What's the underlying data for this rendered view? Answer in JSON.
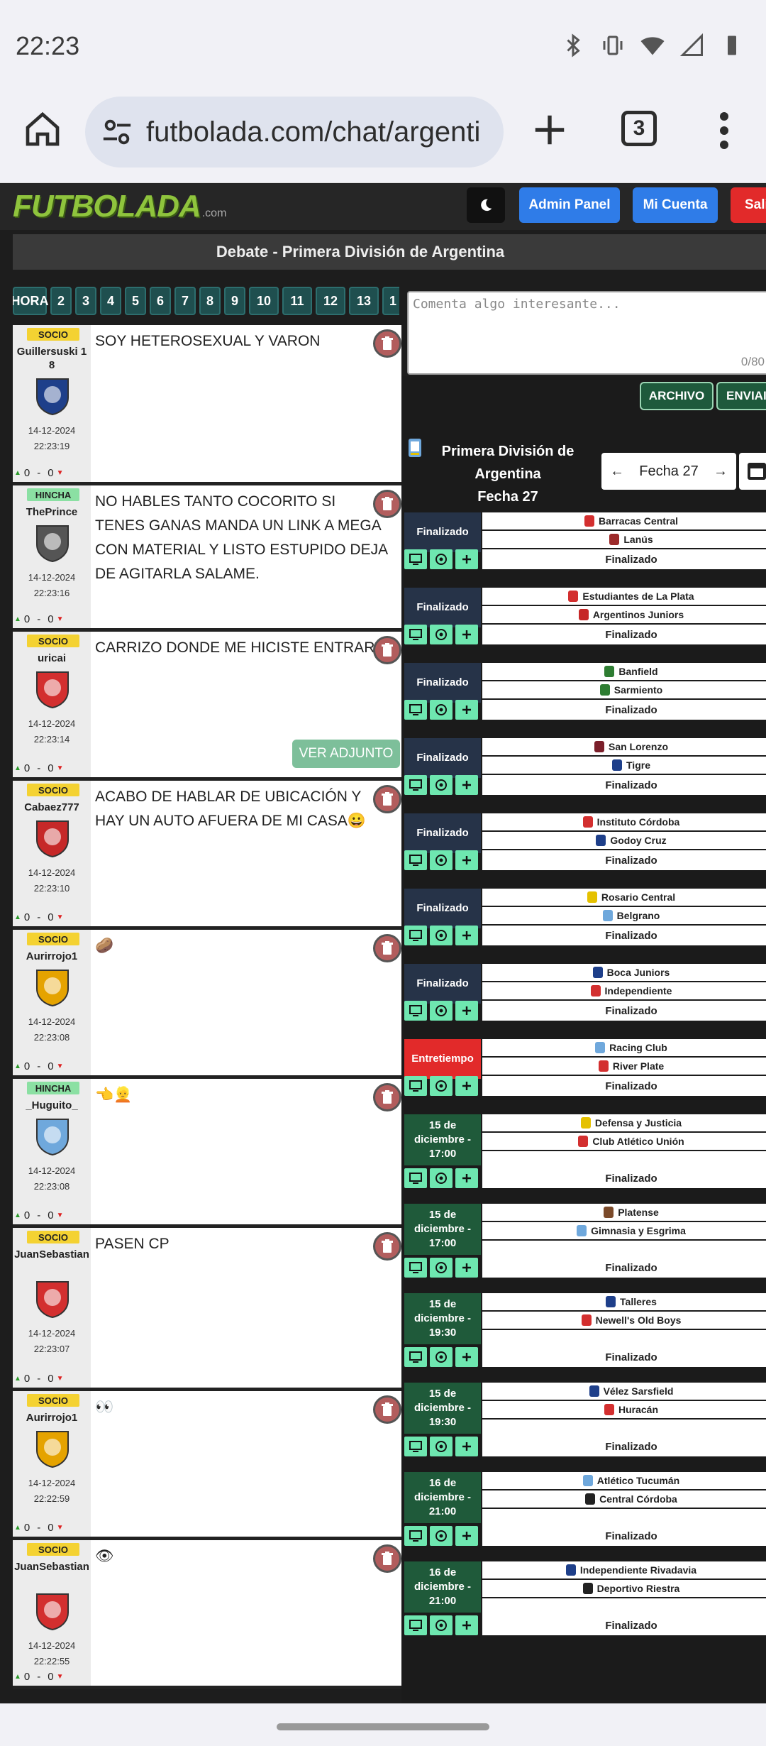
{
  "status": {
    "time": "22:23"
  },
  "browser": {
    "url": "futbolada.com/chat/argenti",
    "tab_count": "3"
  },
  "header": {
    "logo_text": "FUTBOLADA",
    "logo_suffix": ".com",
    "admin_label": "Admin Panel",
    "cuenta_label": "Mi Cuenta",
    "salir_label": "Sali"
  },
  "debate_title": "Debate - Primera División de Argentina",
  "hour_tabs": [
    "HORA",
    "2",
    "3",
    "4",
    "5",
    "6",
    "7",
    "8",
    "9",
    "10",
    "11",
    "12",
    "13",
    "1"
  ],
  "messages": [
    {
      "role": "SOCIO",
      "user": "Guillersuski 18",
      "date": "14-12-2024",
      "time": "22:23:19",
      "up": "0",
      "down": "0",
      "text": "SOY HETEROSEXUAL Y VARON",
      "crest": "#1e3f8a"
    },
    {
      "role": "HINCHA",
      "user": "ThePrince",
      "date": "14-12-2024",
      "time": "22:23:16",
      "up": "0",
      "down": "0",
      "text": "NO HABLES TANTO COCORITO SI TENES GANAS MANDA UN LINK A MEGA CON MATERIAL Y LISTO ESTUPIDO DEJA DE AGITARLA SALAME.",
      "crest": "#555555"
    },
    {
      "role": "SOCIO",
      "user": "uricai",
      "date": "14-12-2024",
      "time": "22:23:14",
      "up": "0",
      "down": "0",
      "text": "CARRIZO DONDE ME HICISTE ENTRAR",
      "attach": "VER ADJUNTO",
      "crest": "#d32f2f"
    },
    {
      "role": "SOCIO",
      "user": "Cabaez777",
      "date": "14-12-2024",
      "time": "22:23:10",
      "up": "0",
      "down": "0",
      "text": "ACABO DE HABLAR DE UBICACIÓN Y HAY UN AUTO AFUERA DE MI CASA😀",
      "crest": "#c62828"
    },
    {
      "role": "SOCIO",
      "user": "Aurirrojo1",
      "date": "14-12-2024",
      "time": "22:23:08",
      "up": "0",
      "down": "0",
      "text": "🥔",
      "crest": "#e5a300"
    },
    {
      "role": "HINCHA",
      "user": "_Huguito_",
      "date": "14-12-2024",
      "time": "22:23:08",
      "up": "0",
      "down": "0",
      "text": "👈👱",
      "crest": "#6fa8dc"
    },
    {
      "role": "SOCIO",
      "user": "JuanSebastian",
      "date": "14-12-2024",
      "time": "22:23:07",
      "up": "0",
      "down": "0",
      "text": "PASEN CP",
      "crest": "#d32f2f"
    },
    {
      "role": "SOCIO",
      "user": "Aurirrojo1",
      "date": "14-12-2024",
      "time": "22:22:59",
      "up": "0",
      "down": "0",
      "text": "👀",
      "crest": "#e5a300"
    },
    {
      "role": "SOCIO",
      "user": "JuanSebastian",
      "date": "14-12-2024",
      "time": "22:22:55",
      "up": "0",
      "down": "0",
      "text": "👁",
      "crest": "#d32f2f"
    }
  ],
  "comment": {
    "placeholder": "Comenta algo interesante...",
    "counter": "0/80"
  },
  "actions": {
    "archivo": "ARCHIVO",
    "enviar": "ENVIAI"
  },
  "league": {
    "name": "Primera División de Argentina",
    "fecha_line": "Fecha 27",
    "selector": "Fecha 27"
  },
  "matches": [
    {
      "status": "Finalizado",
      "kind": "fin",
      "home": "Barracas Central",
      "away": "Lanús",
      "result": "Finalizado",
      "hc": "#d32f2f",
      "ac": "#9c2a2a"
    },
    {
      "status": "Finalizado",
      "kind": "fin",
      "home": "Estudiantes de La Plata",
      "away": "Argentinos Juniors",
      "result": "Finalizado",
      "hc": "#d32f2f",
      "ac": "#c62828"
    },
    {
      "status": "Finalizado",
      "kind": "fin",
      "home": "Banfield",
      "away": "Sarmiento",
      "result": "Finalizado",
      "hc": "#2e7d32",
      "ac": "#2e7d32"
    },
    {
      "status": "Finalizado",
      "kind": "fin",
      "home": "San Lorenzo",
      "away": "Tigre",
      "result": "Finalizado",
      "hc": "#7b1f2a",
      "ac": "#1e3f8a"
    },
    {
      "status": "Finalizado",
      "kind": "fin",
      "home": "Instituto Córdoba",
      "away": "Godoy Cruz",
      "result": "Finalizado",
      "hc": "#d32f2f",
      "ac": "#1e3f8a"
    },
    {
      "status": "Finalizado",
      "kind": "fin",
      "home": "Rosario Central",
      "away": "Belgrano",
      "result": "Finalizado",
      "hc": "#e5c100",
      "ac": "#6fa8dc"
    },
    {
      "status": "Finalizado",
      "kind": "fin",
      "home": "Boca Juniors",
      "away": "Independiente",
      "result": "Finalizado",
      "hc": "#1e3f8a",
      "ac": "#d32f2f"
    },
    {
      "status": "Entretiempo",
      "kind": "live",
      "home": "Racing Club",
      "away": "River Plate",
      "result": "Finalizado",
      "hc": "#6fa8dc",
      "ac": "#d32f2f"
    },
    {
      "status": "15 de diciembre - 17:00",
      "kind": "sched",
      "home": "Defensa y Justicia",
      "away": "Club Atlético Unión",
      "result": "Finalizado",
      "hc": "#e5c100",
      "ac": "#d32f2f"
    },
    {
      "status": "15 de diciembre - 17:00",
      "kind": "sched",
      "home": "Platense",
      "away": "Gimnasia y Esgrima",
      "result": "Finalizado",
      "hc": "#7b4a2a",
      "ac": "#6fa8dc"
    },
    {
      "status": "15 de diciembre - 19:30",
      "kind": "sched",
      "home": "Talleres",
      "away": "Newell's Old Boys",
      "result": "Finalizado",
      "hc": "#1e3f8a",
      "ac": "#d32f2f"
    },
    {
      "status": "15 de diciembre - 19:30",
      "kind": "sched",
      "home": "Vélez Sarsfield",
      "away": "Huracán",
      "result": "Finalizado",
      "hc": "#1e3f8a",
      "ac": "#d32f2f"
    },
    {
      "status": "16 de diciembre - 21:00",
      "kind": "sched",
      "home": "Atlético Tucumán",
      "away": "Central Córdoba",
      "result": "Finalizado",
      "hc": "#6fa8dc",
      "ac": "#222222"
    },
    {
      "status": "16 de diciembre - 21:00",
      "kind": "sched",
      "home": "Independiente Rivadavia",
      "away": "Deportivo Riestra",
      "result": "Finalizado",
      "hc": "#1e3f8a",
      "ac": "#222222"
    }
  ]
}
